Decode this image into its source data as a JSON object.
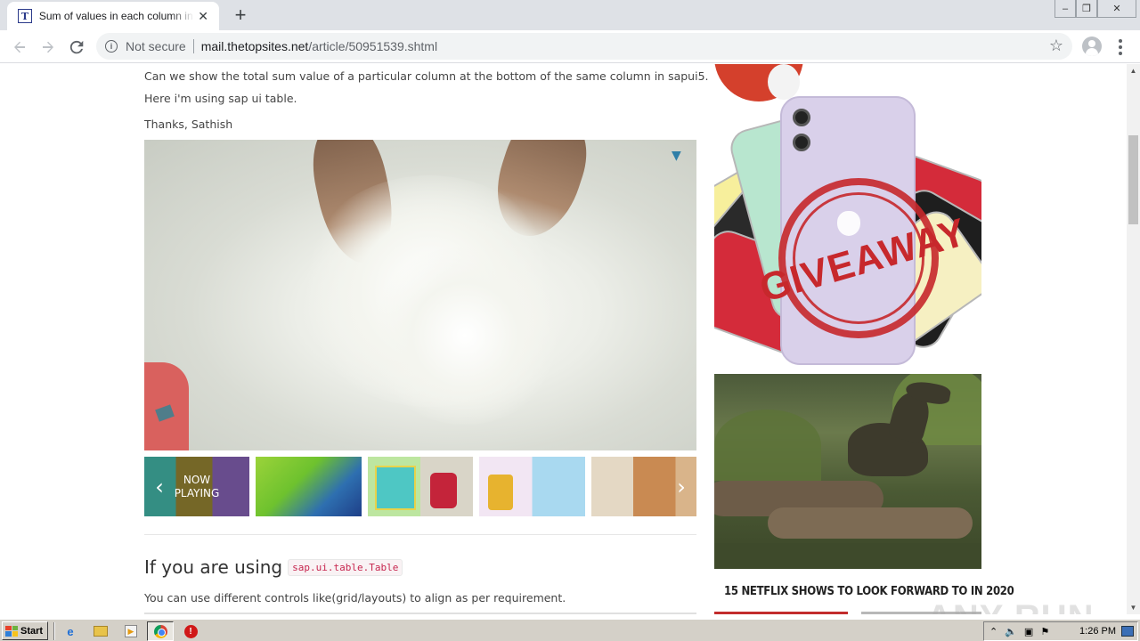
{
  "browser": {
    "tab": {
      "title": "Sum of values in each column in a table",
      "favicon_letter": "T"
    },
    "new_tab_symbol": "+",
    "omnibox": {
      "security_label": "Not secure",
      "url_host": "mail.thetopsites.net",
      "url_path": "/article/50951539.shtml"
    },
    "window_controls": [
      "–",
      "❒",
      "✕"
    ]
  },
  "article": {
    "question_line1": "Can we show the total sum value of a particular column at the bottom of the same column in sapui5.",
    "question_line2": "Here i'm using sap ui table.",
    "signature": "Thanks, Sathish",
    "now_playing": "NOW PLAYING",
    "answer_heading": "If you are using",
    "answer_code": "sap.ui.table.Table",
    "answer_text": "You can use different controls like(grid/layouts) to align as per requirement."
  },
  "sidebar": {
    "giveaway_text": "GIVEAWAY",
    "netflix_caption": "15 NETFLIX SHOWS TO LOOK FORWARD TO IN 2020"
  },
  "watermark": "ANY RUN",
  "taskbar": {
    "start_label": "Start",
    "clock": "1:26 PM"
  },
  "colors": {
    "chrome_tabstrip": "#dee1e6",
    "stamp_red": "#c7282c",
    "taskbar_gray": "#d4d0c8",
    "code_pink": "#c7254e"
  }
}
